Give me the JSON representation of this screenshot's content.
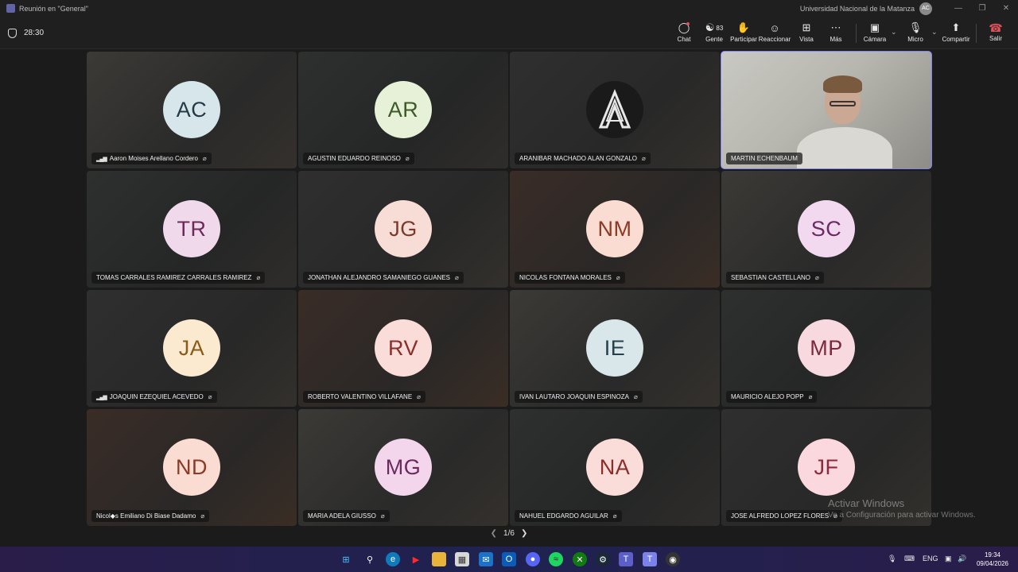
{
  "window": {
    "title": "Reunión en \"General\"",
    "organization": "Universidad Nacional de la Matanza",
    "org_avatar": "AC"
  },
  "meeting": {
    "timer": "28:30",
    "people_count": "83"
  },
  "toolbar": {
    "chat": "Chat",
    "people": "Gente",
    "raise": "Participar",
    "react": "Reaccionar",
    "view": "Vista",
    "more": "Más",
    "camera": "Cámara",
    "mic": "Micro",
    "share": "Compartir",
    "leave": "Salir"
  },
  "participants": [
    {
      "initials": "AC",
      "name": "Aaron Moises Arellano Cordero",
      "bg": "#d7e6ea",
      "fg": "#243a45",
      "signal": true
    },
    {
      "initials": "AR",
      "name": "AGUSTIN EDUARDO REINOSO",
      "bg": "#e6f1d8",
      "fg": "#3e5a2a",
      "signal": false
    },
    {
      "initials": "",
      "name": "ARANIBAR MACHADO ALAN GONZALO",
      "bg": "#1a1a1a",
      "fg": "#ffffff",
      "signal": false,
      "logo": true
    },
    {
      "initials": "",
      "name": "MARTIN ECHENBAUM",
      "video": true,
      "signal": false
    },
    {
      "initials": "TR",
      "name": "TOMAS CARRALES RAMIREZ CARRALES RAMIREZ",
      "bg": "#f1d9ec",
      "fg": "#6b2a5a",
      "signal": false
    },
    {
      "initials": "JG",
      "name": "JONATHAN ALEJANDRO SAMANIEGO GUANES",
      "bg": "#f7ddd6",
      "fg": "#7a3a2a",
      "signal": false
    },
    {
      "initials": "NM",
      "name": "NICOLAS FONTANA MORALES",
      "bg": "#fbdcd2",
      "fg": "#8a3a25",
      "signal": false
    },
    {
      "initials": "SC",
      "name": "SEBASTIAN CASTELLANO",
      "bg": "#f3d9ef",
      "fg": "#6a2a63",
      "signal": false
    },
    {
      "initials": "JA",
      "name": "JOAQUIN EZEQUIEL ACEVEDO",
      "bg": "#fbe9d0",
      "fg": "#8a5a1a",
      "signal": true
    },
    {
      "initials": "RV",
      "name": "ROBERTO VALENTINO VILLAFANE",
      "bg": "#fadcd8",
      "fg": "#8a2e2a",
      "signal": false
    },
    {
      "initials": "IE",
      "name": "IVAN LAUTARO JOAQUIN ESPINOZA",
      "bg": "#d9e6ea",
      "fg": "#22424f",
      "signal": false
    },
    {
      "initials": "MP",
      "name": "MAURICIO ALEJO POPP",
      "bg": "#f8d9df",
      "fg": "#7a2a3a",
      "signal": false
    },
    {
      "initials": "ND",
      "name": "Nicol◆s Emiliano Di Biase Dadamo",
      "bg": "#fbdcd2",
      "fg": "#8a3a25",
      "signal": false
    },
    {
      "initials": "MG",
      "name": "MARIA ADELA GIUSSO",
      "bg": "#f3d6ec",
      "fg": "#6a2a5e",
      "signal": false
    },
    {
      "initials": "NA",
      "name": "NAHUEL EDGARDO AGUILAR",
      "bg": "#fadcd8",
      "fg": "#8a2e2a",
      "signal": false
    },
    {
      "initials": "JF",
      "name": "JOSE ALFREDO LOPEZ FLORES",
      "bg": "#fad8de",
      "fg": "#8a2a3c",
      "signal": false
    }
  ],
  "pager": "1/6",
  "watermark": {
    "line1": "Activar Windows",
    "line2": "Ve a Configuración para activar Windows."
  },
  "taskbar": {
    "lang": "ENG",
    "time": "19:34",
    "date": "09/04/2026"
  }
}
